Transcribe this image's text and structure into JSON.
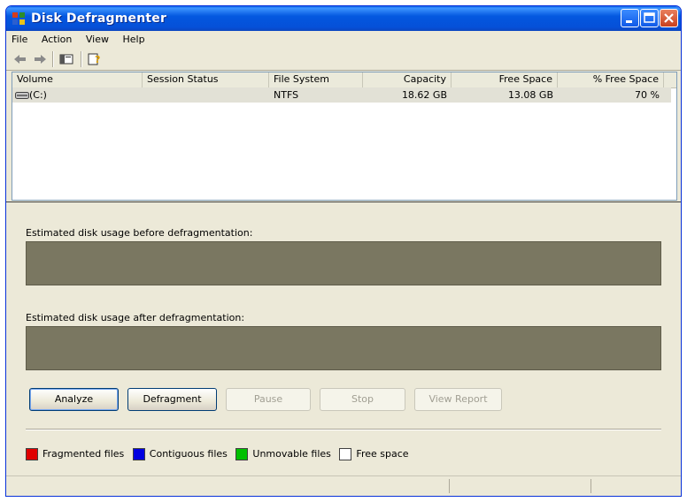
{
  "window": {
    "title": "Disk Defragmenter"
  },
  "menu": [
    "File",
    "Action",
    "View",
    "Help"
  ],
  "toolbar": {
    "icons": [
      "back-arrow-icon",
      "forward-arrow-icon",
      "show-hide-console-tree-icon",
      "help-icon"
    ]
  },
  "columns": [
    {
      "label": "Volume"
    },
    {
      "label": "Session Status"
    },
    {
      "label": "File System"
    },
    {
      "label": "Capacity"
    },
    {
      "label": "Free Space"
    },
    {
      "label": "% Free Space"
    }
  ],
  "volumes": [
    {
      "volume": "(C:)",
      "session_status": "",
      "file_system": "NTFS",
      "capacity": "18.62 GB",
      "free_space": "13.08 GB",
      "pct_free": "70 %"
    }
  ],
  "usage_before_label": "Estimated disk usage before defragmentation:",
  "usage_after_label": "Estimated disk usage after defragmentation:",
  "buttons": {
    "analyze": "Analyze",
    "defragment": "Defragment",
    "pause": "Pause",
    "stop": "Stop",
    "view_report": "View Report"
  },
  "legend": [
    {
      "label": "Fragmented files",
      "color": "#e00000"
    },
    {
      "label": "Contiguous files",
      "color": "#0000e0"
    },
    {
      "label": "Unmovable files",
      "color": "#00c000"
    },
    {
      "label": "Free space",
      "color": "#ffffff"
    }
  ],
  "colors": {
    "usage_bar": "#7a7761",
    "title_bar": "#0458e0"
  }
}
